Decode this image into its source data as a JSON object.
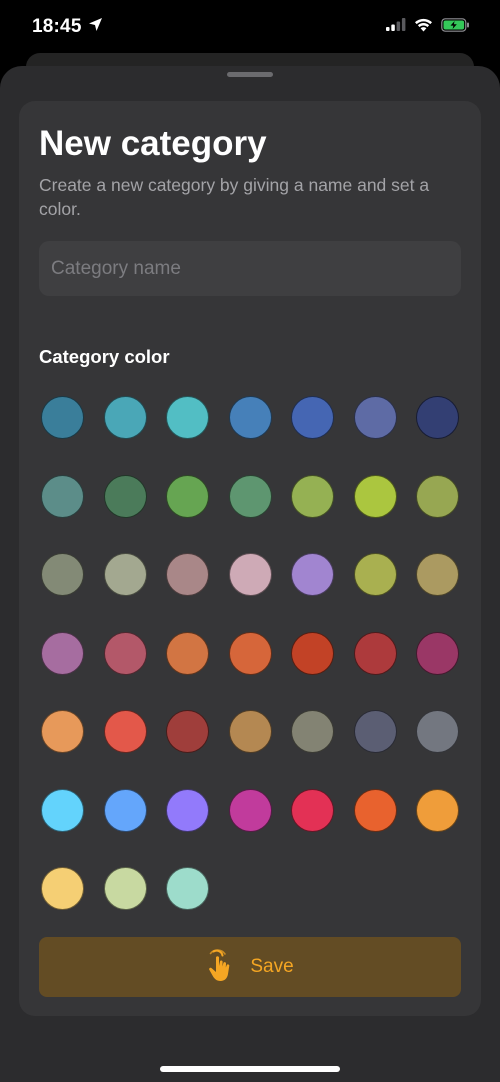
{
  "status_bar": {
    "time": "18:45",
    "icons": [
      "location-arrow-icon",
      "cellular-signal-icon",
      "wifi-icon",
      "battery-charging-icon"
    ]
  },
  "sheet": {
    "title": "New category",
    "subtitle": "Create a new category by giving a name and set a color.",
    "name_input": {
      "value": "",
      "placeholder": "Category name"
    },
    "color_label": "Category color",
    "colors": [
      [
        "#3a7e9a",
        "#4aa7b7",
        "#52bec4",
        "#4680b9",
        "#4566b3",
        "#5e6ba5",
        "#333f73"
      ],
      [
        "#5c8d89",
        "#4b7b5a",
        "#66a552",
        "#5e9670",
        "#95b153",
        "#abc63f",
        "#97a752"
      ],
      [
        "#838a76",
        "#a3a890",
        "#a98788",
        "#ceaab6",
        "#a185d0",
        "#a9b050",
        "#ab9a61"
      ],
      [
        "#a66da0",
        "#b35869",
        "#d27543",
        "#d6663a",
        "#c24226",
        "#ad3a3c",
        "#9a3766"
      ],
      [
        "#e7995a",
        "#e3584a",
        "#9f3e3b",
        "#b48852",
        "#838373",
        "#5b5e73",
        "#737780"
      ],
      [
        "#63d3fc",
        "#64a6fb",
        "#927afb",
        "#c13b9c",
        "#e33155",
        "#e8622e",
        "#ef9d3a"
      ],
      [
        "#f5cf74",
        "#c8d9a1",
        "#9ddccb"
      ]
    ],
    "save_button": {
      "label": "Save",
      "icon": "tap-hand-icon"
    }
  },
  "theme": {
    "background": "#000000",
    "sheet_background": "#2c2c2e",
    "card_background": "#363638",
    "accent": "#f5a623",
    "save_button_background": "#634c24"
  }
}
